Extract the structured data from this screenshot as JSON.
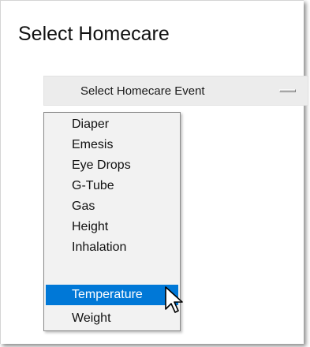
{
  "window": {
    "title": "Select Homecare"
  },
  "select": {
    "label": "Select Homecare Event",
    "indicator_icon": "dropdown-indicator-icon"
  },
  "dropdown": {
    "options": [
      "Diaper",
      "Emesis",
      "Eye Drops",
      "G-Tube",
      "Gas",
      "Height",
      "Inhalation",
      "Temperature",
      "Weight"
    ],
    "highlighted": "Temperature"
  },
  "colors": {
    "highlight": "#0078d7",
    "dropdown_bg": "#f2f2f2",
    "button_bg": "#ececec"
  },
  "cursor": {
    "icon": "mouse-pointer-icon"
  }
}
